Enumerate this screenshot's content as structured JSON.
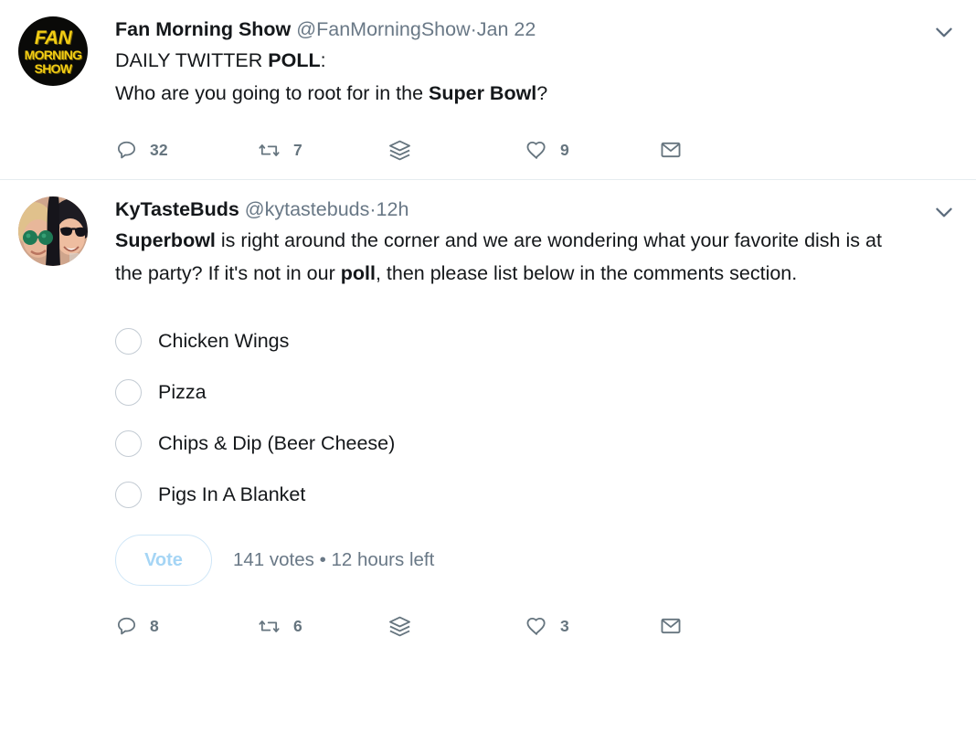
{
  "theme": {
    "text_primary": "#14171a",
    "text_muted": "#697886",
    "action_icon": "#66757f",
    "divider": "#e6ecf0",
    "vote_accent": "#a5d5f5",
    "vote_border": "#cfe6f7",
    "radio_border": "#c4ccd4",
    "background": "#ffffff"
  },
  "tweets": [
    {
      "avatar": {
        "type": "logo",
        "name": "fan-morning-show-logo",
        "line1": "FAN",
        "line2": "MORNING",
        "line3": "SHOW",
        "background": "#0a0a08",
        "text_color": "#f2cc14"
      },
      "display_name": "Fan Morning Show",
      "handle": "@FanMorningShow",
      "separator": "·",
      "timestamp": "Jan 22",
      "caret_icon": "chevron-down-icon",
      "text_line1_a": "DAILY TWITTER ",
      "text_line1_b": "POLL",
      "text_line1_c": ":",
      "text_line2_a": "Who are you going to root for in the ",
      "text_line2_b": "Super Bowl",
      "text_line2_c": "?",
      "actions": {
        "reply": {
          "icon": "reply-icon",
          "count": "32"
        },
        "retweet": {
          "icon": "retweet-icon",
          "count": "7"
        },
        "stack": {
          "icon": "stack-icon",
          "count": ""
        },
        "like": {
          "icon": "heart-icon",
          "count": "9"
        },
        "message": {
          "icon": "envelope-icon",
          "count": ""
        }
      }
    },
    {
      "avatar": {
        "type": "photo",
        "name": "kytastebuds-photo",
        "alt": "two-women-sunglasses-selfie"
      },
      "display_name": "KyTasteBuds",
      "handle": "@kytastebuds",
      "separator": "·",
      "timestamp": "12h",
      "caret_icon": "chevron-down-icon",
      "text_a": "Superbowl",
      "text_b": " is right around the corner and we are wondering what your favorite dish is at the party?  If it's not in our ",
      "text_c": "poll",
      "text_d": ", then please list below in the comments section.",
      "poll": {
        "options": [
          {
            "label": "Chicken Wings"
          },
          {
            "label": "Pizza"
          },
          {
            "label": "Chips & Dip (Beer Cheese)"
          },
          {
            "label": "Pigs In A Blanket"
          }
        ],
        "vote_button_label": "Vote",
        "meta": "141 votes • 12 hours left",
        "votes_count": "141",
        "time_left": "12 hours left"
      },
      "actions": {
        "reply": {
          "icon": "reply-icon",
          "count": "8"
        },
        "retweet": {
          "icon": "retweet-icon",
          "count": "6"
        },
        "stack": {
          "icon": "stack-icon",
          "count": ""
        },
        "like": {
          "icon": "heart-icon",
          "count": "3"
        },
        "message": {
          "icon": "envelope-icon",
          "count": ""
        }
      }
    }
  ]
}
